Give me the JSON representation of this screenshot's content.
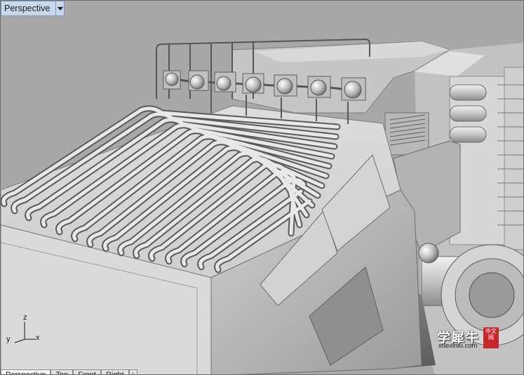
{
  "viewport": {
    "title": "Perspective"
  },
  "axes": {
    "z": "z",
    "y": "y",
    "x": "x"
  },
  "watermark": {
    "text": "学犀牛",
    "url": "xuexiniu.com",
    "seal": "中文网"
  },
  "view_tabs": [
    "Perspective",
    "Top",
    "Front",
    "Right"
  ],
  "colors": {
    "viewport_background": "#a8a8a8",
    "title_bar": "#c9d9ec",
    "active_tab": "#ffffff"
  },
  "icons": {
    "dropdown": "triangle-down-icon",
    "tab_add": "add-view-icon"
  }
}
